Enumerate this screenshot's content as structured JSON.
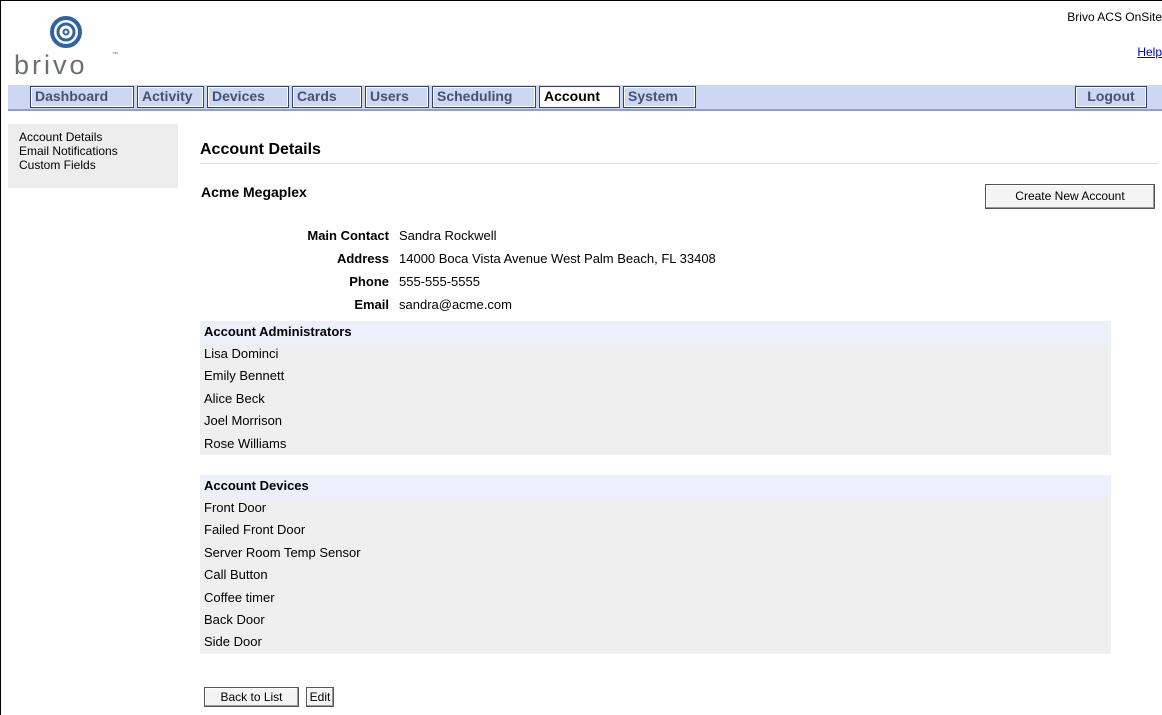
{
  "brand": {
    "logo_text": "brivo",
    "tm": "™",
    "app_title": "Brivo ACS OnSite",
    "help_label": "Help"
  },
  "nav": {
    "tabs": [
      {
        "label": "Dashboard"
      },
      {
        "label": "Activity"
      },
      {
        "label": "Devices"
      },
      {
        "label": "Cards"
      },
      {
        "label": "Users"
      },
      {
        "label": "Scheduling"
      },
      {
        "label": "Account",
        "active": true
      },
      {
        "label": "System"
      }
    ],
    "logout_label": "Logout"
  },
  "sidebar": {
    "items": [
      {
        "label": "Account Details"
      },
      {
        "label": "Email Notifications"
      },
      {
        "label": "Custom Fields"
      }
    ]
  },
  "page": {
    "title": "Account Details",
    "account_name": "Acme Megaplex",
    "create_button": "Create New Account",
    "details": [
      {
        "label": "Main Contact",
        "value": "Sandra Rockwell"
      },
      {
        "label": "Address",
        "value": "14000 Boca Vista Avenue West Palm Beach, FL 33408"
      },
      {
        "label": "Phone",
        "value": "555-555-5555"
      },
      {
        "label": "Email",
        "value": "sandra@acme.com"
      }
    ],
    "administrators": {
      "header": "Account Administrators",
      "items": [
        "Lisa Dominci",
        "Emily Bennett",
        "Alice Beck",
        "Joel Morrison",
        "Rose Williams"
      ]
    },
    "devices": {
      "header": "Account Devices",
      "items": [
        "Front Door",
        "Failed Front Door",
        "Server Room Temp Sensor",
        "Call Button",
        "Coffee timer",
        "Back Door",
        "Side Door"
      ]
    },
    "back_button": "Back to List",
    "edit_button": "Edit"
  },
  "colors": {
    "nav_bg": "#cdd7f3",
    "tab_text": "#44536f",
    "panel_bg": "#efefef",
    "panel_header_bg": "#ecf0fb",
    "logo": "#2f63a8"
  }
}
